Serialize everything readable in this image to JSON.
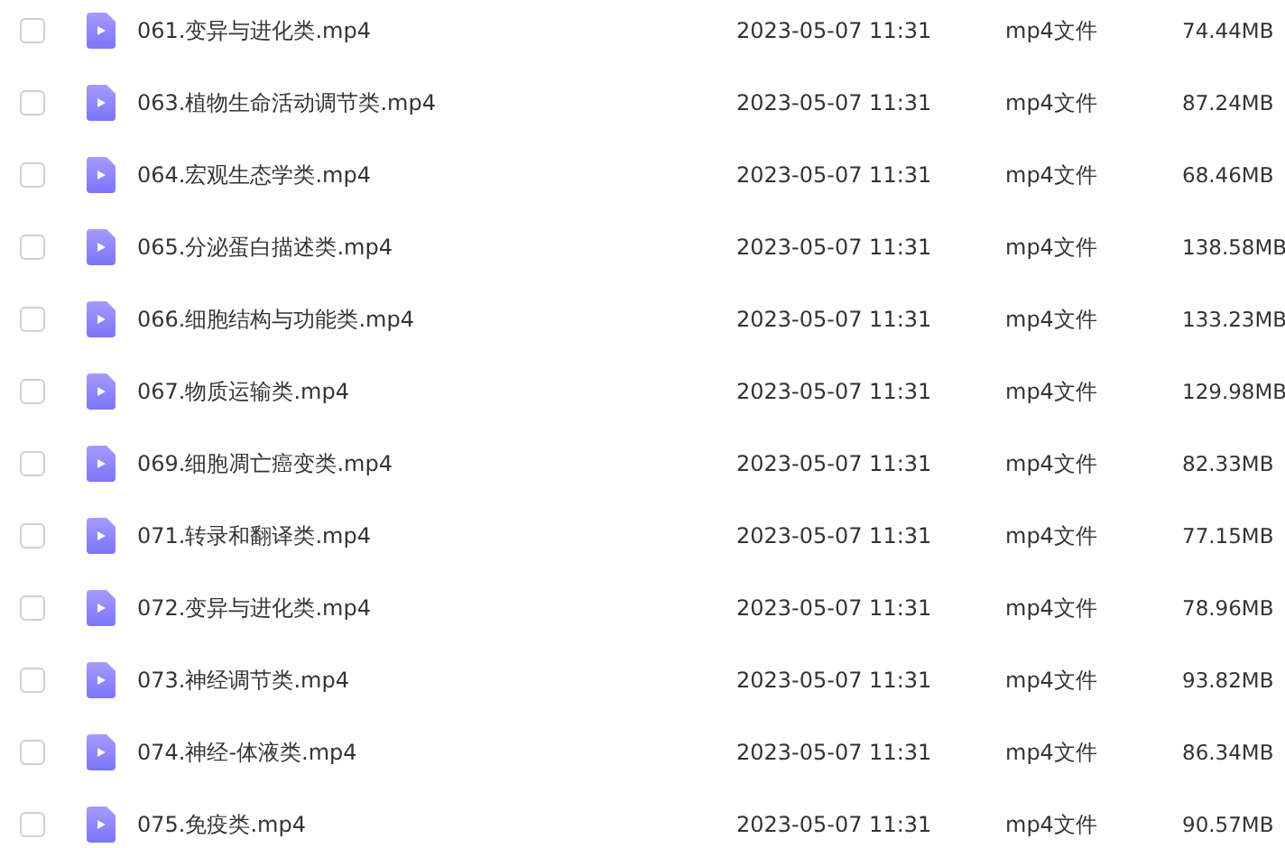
{
  "files": [
    {
      "name": "061.变异与进化类.mp4",
      "date": "2023-05-07 11:31",
      "type": "mp4文件",
      "size": "74.44MB",
      "checked": false
    },
    {
      "name": "063.植物生命活动调节类.mp4",
      "date": "2023-05-07 11:31",
      "type": "mp4文件",
      "size": "87.24MB",
      "checked": false
    },
    {
      "name": "064.宏观生态学类.mp4",
      "date": "2023-05-07 11:31",
      "type": "mp4文件",
      "size": "68.46MB",
      "checked": false
    },
    {
      "name": "065.分泌蛋白描述类.mp4",
      "date": "2023-05-07 11:31",
      "type": "mp4文件",
      "size": "138.58MB",
      "checked": false
    },
    {
      "name": "066.细胞结构与功能类.mp4",
      "date": "2023-05-07 11:31",
      "type": "mp4文件",
      "size": "133.23MB",
      "checked": false
    },
    {
      "name": "067.物质运输类.mp4",
      "date": "2023-05-07 11:31",
      "type": "mp4文件",
      "size": "129.98MB",
      "checked": false
    },
    {
      "name": "069.细胞凋亡癌变类.mp4",
      "date": "2023-05-07 11:31",
      "type": "mp4文件",
      "size": "82.33MB",
      "checked": false
    },
    {
      "name": "071.转录和翻译类.mp4",
      "date": "2023-05-07 11:31",
      "type": "mp4文件",
      "size": "77.15MB",
      "checked": false
    },
    {
      "name": "072.变异与进化类.mp4",
      "date": "2023-05-07 11:31",
      "type": "mp4文件",
      "size": "78.96MB",
      "checked": false
    },
    {
      "name": "073.神经调节类.mp4",
      "date": "2023-05-07 11:31",
      "type": "mp4文件",
      "size": "93.82MB",
      "checked": false
    },
    {
      "name": "074.神经-体液类.mp4",
      "date": "2023-05-07 11:31",
      "type": "mp4文件",
      "size": "86.34MB",
      "checked": false
    },
    {
      "name": "075.免疫类.mp4",
      "date": "2023-05-07 11:31",
      "type": "mp4文件",
      "size": "90.57MB",
      "checked": false
    }
  ]
}
